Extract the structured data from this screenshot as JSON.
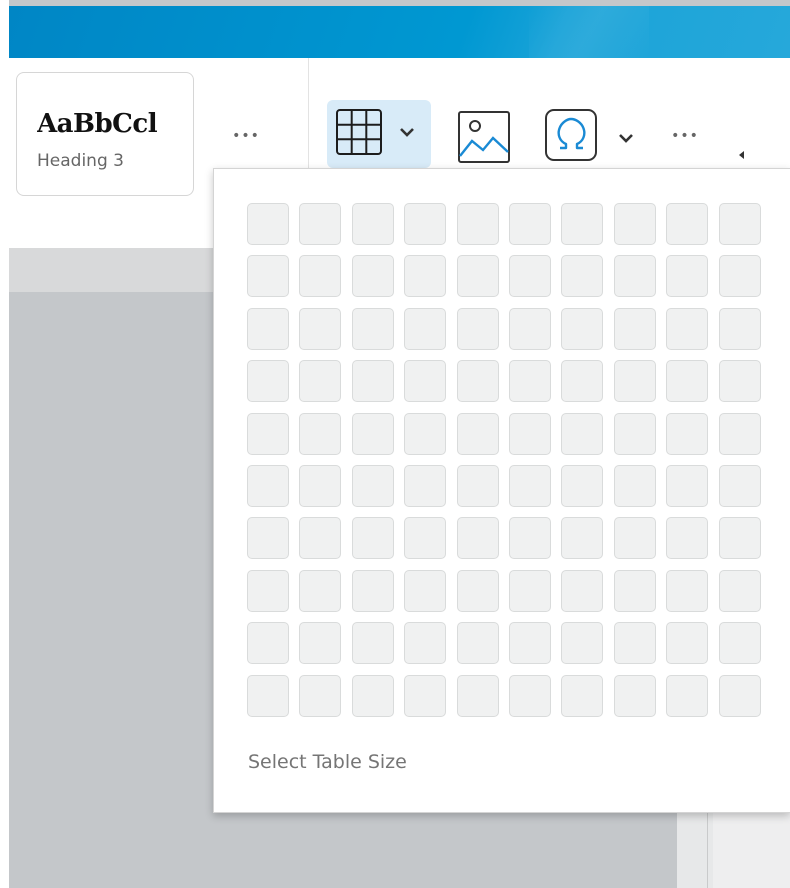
{
  "ribbon": {
    "style_card": {
      "sample_text": "AaBbCcl",
      "style_name": "Heading 3"
    },
    "more_styles_label": "•••",
    "insert": {
      "table_icon": "table-grid-icon",
      "image_icon": "image-icon",
      "symbol_icon": "omega-icon",
      "more_label": "•••"
    }
  },
  "table_picker": {
    "rows": 10,
    "columns": 10,
    "label": "Select Table Size"
  },
  "colors": {
    "title_bar": "#0098d2",
    "accent": "#1a8ad4",
    "active_button_bg": "#d8ebf8",
    "cell_bg": "#f0f1f1",
    "document_bg": "#c4c7ca"
  }
}
